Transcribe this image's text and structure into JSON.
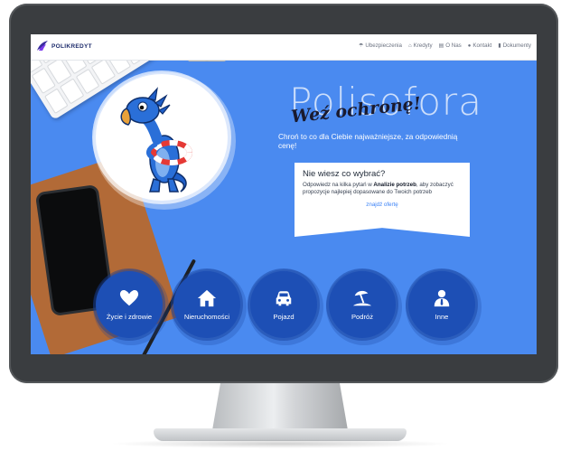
{
  "brand": {
    "name": "POLIKREDYT"
  },
  "nav": [
    {
      "icon": "umbrella-icon",
      "label": "Ubezpieczenia"
    },
    {
      "icon": "home-icon",
      "label": "Kredyty"
    },
    {
      "icon": "building-icon",
      "label": "O Nas"
    },
    {
      "icon": "map-pin-icon",
      "label": "Kontakt"
    },
    {
      "icon": "document-icon",
      "label": "Dokumenty"
    }
  ],
  "hero": {
    "title": "Polisofora",
    "script": "Weź ochronę!",
    "subtitle": "Chroń to co dla Ciebie najważniejsze, za odpowiednią cenę!"
  },
  "card": {
    "title": "Nie wiesz co wybrać?",
    "text_before": "Odpowiedz na kilka pytań w ",
    "text_bold": "Analizie potrzeb",
    "text_after": ", aby zobaczyć propozycje najlepiej dopasowane do Twoich potrzeb",
    "link": "znajdź ofertę"
  },
  "categories": [
    {
      "icon": "heart-icon",
      "label": "Życie i zdrowie"
    },
    {
      "icon": "house-icon",
      "label": "Nieruchomości"
    },
    {
      "icon": "car-icon",
      "label": "Pojazd"
    },
    {
      "icon": "beach-umbrella-icon",
      "label": "Podróż"
    },
    {
      "icon": "person-icon",
      "label": "Inne"
    }
  ],
  "colors": {
    "screen_bg": "#4a8af0",
    "category_bg": "#1d4fb5",
    "link": "#3b82f6",
    "monitor": "#3a3d40"
  }
}
